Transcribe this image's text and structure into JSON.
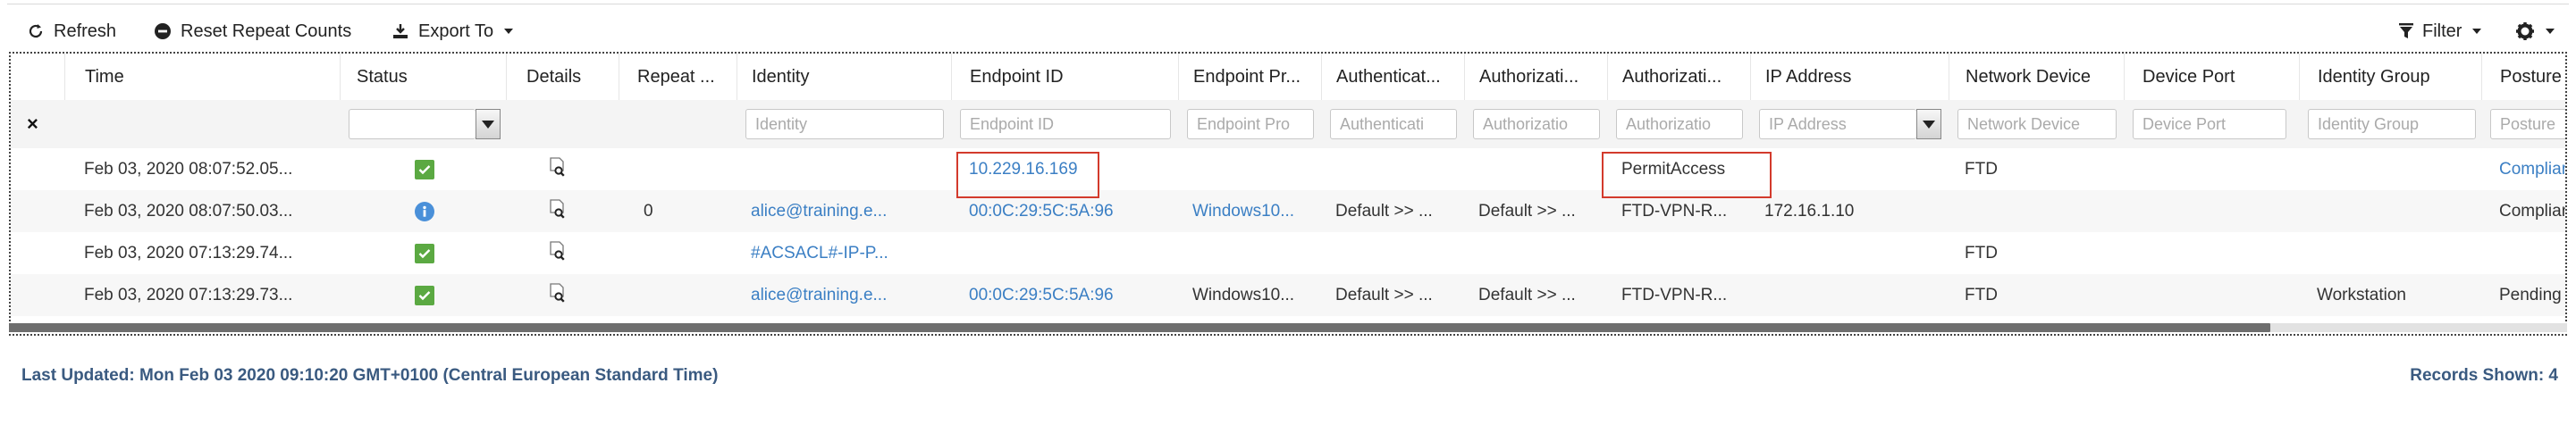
{
  "toolbar": {
    "refresh": "Refresh",
    "reset_repeat_counts": "Reset Repeat Counts",
    "export_to": "Export To",
    "filter": "Filter"
  },
  "columns": [
    "Time",
    "Status",
    "Details",
    "Repeat ...",
    "Identity",
    "Endpoint ID",
    "Endpoint Pr...",
    "Authenticat...",
    "Authorizati...",
    "Authorizati...",
    "IP Address",
    "Network Device",
    "Device Port",
    "Identity Group",
    "Posture S"
  ],
  "filter_row": {
    "clear": "×",
    "status_value": "",
    "placeholders": {
      "identity": "Identity",
      "endpoint_id": "Endpoint ID",
      "endpoint_profile": "Endpoint Pro",
      "authentication": "Authenticati",
      "authz_policy": "Authorizatio",
      "authz_profile": "Authorizatio",
      "ip_address": "IP Address",
      "network_device": "Network Device",
      "device_port": "Device Port",
      "identity_group": "Identity Group",
      "posture": "Posture"
    }
  },
  "rows": [
    {
      "time": "Feb 03, 2020 08:07:52.05...",
      "status": "success",
      "repeat": "",
      "identity": "",
      "endpoint_id": "10.229.16.169",
      "endpoint_profile": "",
      "authentication": "",
      "authz_policy": "",
      "authz_profile": "PermitAccess",
      "ip_address": "",
      "network_device": "FTD",
      "device_port": "",
      "identity_group": "",
      "posture": "Complian"
    },
    {
      "time": "Feb 03, 2020 08:07:50.03...",
      "status": "info",
      "repeat": "0",
      "identity": "alice@training.e...",
      "endpoint_id": "00:0C:29:5C:5A:96",
      "endpoint_profile": "Windows10...",
      "authentication": "Default >> ...",
      "authz_policy": "Default >> ...",
      "authz_profile": "FTD-VPN-R...",
      "ip_address": "172.16.1.10",
      "network_device": "",
      "device_port": "",
      "identity_group": "",
      "posture": "Complian"
    },
    {
      "time": "Feb 03, 2020 07:13:29.74...",
      "status": "success",
      "repeat": "",
      "identity": "#ACSACL#-IP-P...",
      "endpoint_id": "",
      "endpoint_profile": "",
      "authentication": "",
      "authz_policy": "",
      "authz_profile": "",
      "ip_address": "",
      "network_device": "FTD",
      "device_port": "",
      "identity_group": "",
      "posture": ""
    },
    {
      "time": "Feb 03, 2020 07:13:29.73...",
      "status": "success",
      "repeat": "",
      "identity": "alice@training.e...",
      "endpoint_id": "00:0C:29:5C:5A:96",
      "endpoint_profile": "Windows10...",
      "authentication": "Default >> ...",
      "authz_policy": "Default >> ...",
      "authz_profile": "FTD-VPN-R...",
      "ip_address": "",
      "network_device": "FTD",
      "device_port": "",
      "identity_group": "Workstation",
      "posture": "Pending"
    }
  ],
  "footer": {
    "last_updated": "Last Updated: Mon Feb 03 2020 09:10:20 GMT+0100 (Central European Standard Time)",
    "records_shown": "Records Shown: 4"
  },
  "colors": {
    "link": "#3b7fc4",
    "success": "#5ba942",
    "info": "#4a90d9",
    "highlight": "#d33a2c",
    "footer_text": "#3a5a80"
  },
  "icons": [
    "refresh-icon",
    "minus-circle-icon",
    "export-icon",
    "filter-icon",
    "gear-icon",
    "details-icon",
    "check-icon",
    "info-icon"
  ]
}
